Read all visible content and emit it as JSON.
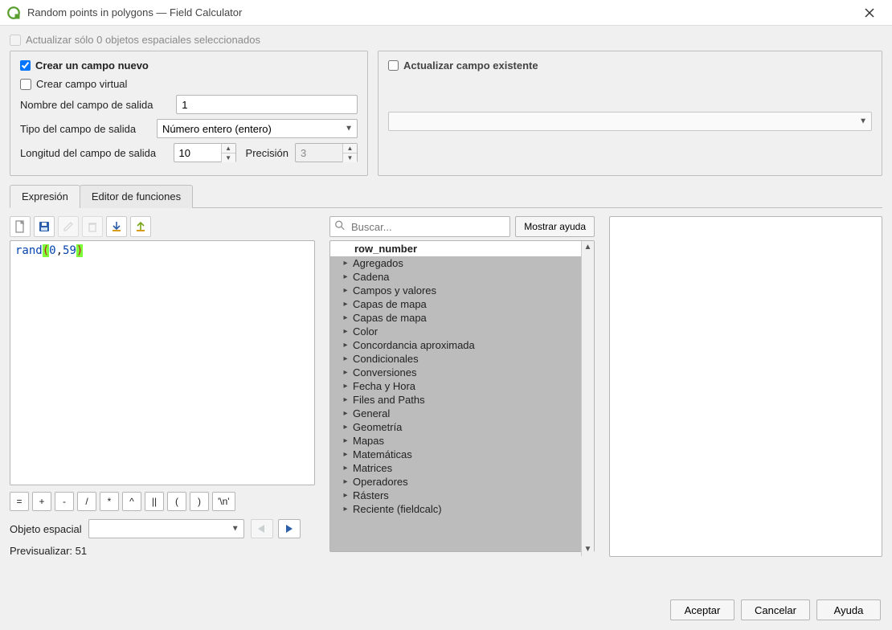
{
  "title": "Random points in polygons — Field Calculator",
  "update_selected": {
    "label": "Actualizar sólo 0 objetos espaciales seleccionados",
    "checked": false
  },
  "left_panel": {
    "create_new_field": {
      "label": "Crear un campo nuevo",
      "checked": true
    },
    "create_virtual": {
      "label": "Crear campo virtual",
      "checked": false
    },
    "output_name_label": "Nombre del campo de salida",
    "output_name_value": "1",
    "output_type_label": "Tipo del campo de salida",
    "output_type_value": "Número entero (entero)",
    "output_length_label": "Longitud del campo de salida",
    "output_length_value": "10",
    "precision_label": "Precisión",
    "precision_value": "3"
  },
  "right_panel": {
    "update_existing": {
      "label": "Actualizar campo existente",
      "checked": false
    },
    "field_combo_value": ""
  },
  "tabs": {
    "expression": "Expresión",
    "function_editor": "Editor de funciones"
  },
  "expression": {
    "fn": "rand",
    "open": "(",
    "arg1": "0",
    "comma": ",",
    "arg2": "59",
    "close": ")"
  },
  "operators": [
    "=",
    "+",
    "-",
    "/",
    "*",
    "^",
    "||",
    "(",
    ")",
    "'\\n'"
  ],
  "feature_label": "Objeto espacial",
  "preview_label": "Previsualizar:",
  "preview_value": "51",
  "search_placeholder": "Buscar...",
  "help_toggle": "Mostrar ayuda",
  "tree": {
    "first": "row_number",
    "groups": [
      "Agregados",
      "Cadena",
      "Campos y valores",
      "Capas de mapa",
      "Capas de mapa",
      "Color",
      "Concordancia aproximada",
      "Condicionales",
      "Conversiones",
      "Fecha y Hora",
      "Files and Paths",
      "General",
      "Geometría",
      "Mapas",
      "Matemáticas",
      "Matrices",
      "Operadores",
      "Rásters",
      "Reciente (fieldcalc)"
    ]
  },
  "footer": {
    "ok": "Aceptar",
    "cancel": "Cancelar",
    "help": "Ayuda"
  }
}
